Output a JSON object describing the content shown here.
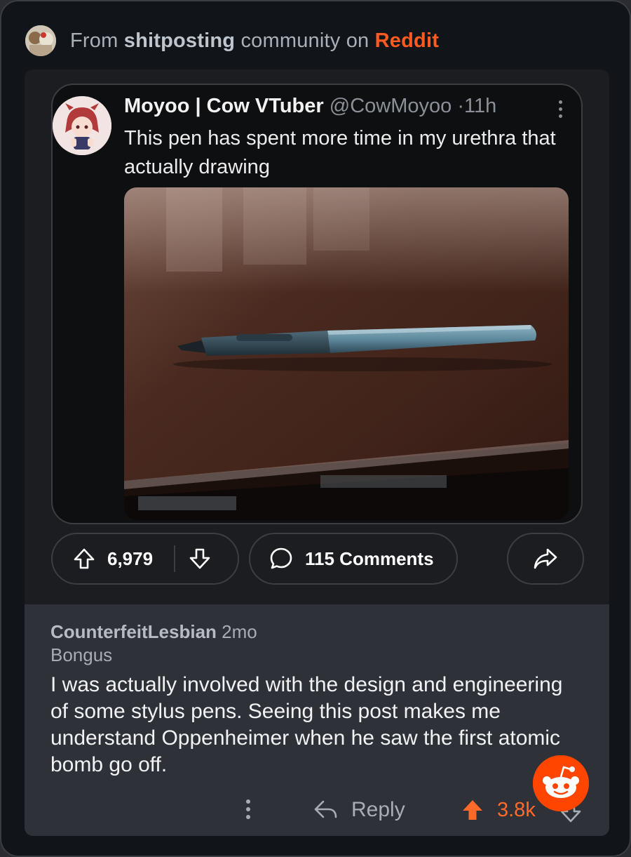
{
  "header": {
    "prefix": "From",
    "community": "shitposting",
    "middle": "community on",
    "platform": "Reddit"
  },
  "tweet": {
    "display_name": "Moyoo | Cow VTuber",
    "handle": "@CowMoyoo",
    "separator": "·",
    "age": "11h",
    "text": "This pen has spent more time in my urethra that actually drawing"
  },
  "post_actions": {
    "votes": "6,979",
    "comments": "115 Comments"
  },
  "comment": {
    "author": "CounterfeitLesbian",
    "age": "2mo",
    "flair": "Bongus",
    "body": "I was actually involved with the design and engineering of some stylus pens. Seeing this post makes me understand Oppenheimer when he saw the first atomic bomb go off.",
    "reply_label": "Reply",
    "score": "3.8k"
  },
  "colors": {
    "brand": "#ff5a1f",
    "upvote": "#ff6a2b",
    "card_bg": "#1c1d20",
    "comment_bg": "#2e3138"
  },
  "icons": [
    "community-avatar",
    "more-vertical-icon",
    "upvote-icon",
    "downvote-icon",
    "comment-icon",
    "share-icon",
    "reply-icon",
    "reddit-snoo-icon"
  ]
}
